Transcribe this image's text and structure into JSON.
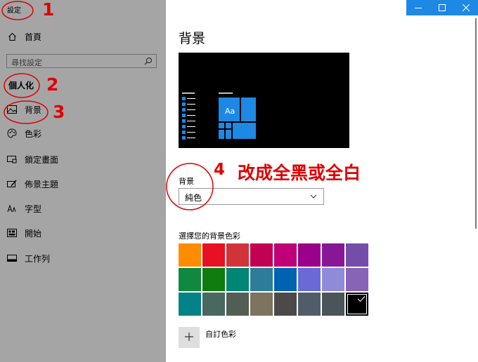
{
  "window": {
    "title": "設定",
    "controls": {
      "minimize": "—",
      "maximize": "☐",
      "close": "✕"
    },
    "accent_color": "#1e88e5"
  },
  "sidebar": {
    "home": {
      "label": "首頁",
      "icon": "home-icon"
    },
    "search": {
      "placeholder": "尋找設定",
      "icon": "search-icon"
    },
    "section_title": "個人化",
    "items": [
      {
        "label": "背景",
        "icon": "picture-icon"
      },
      {
        "label": "色彩",
        "icon": "palette-icon"
      },
      {
        "label": "鎖定畫面",
        "icon": "lock-screen-icon"
      },
      {
        "label": "佈景主題",
        "icon": "theme-brush-icon"
      },
      {
        "label": "字型",
        "icon": "font-icon"
      },
      {
        "label": "開始",
        "icon": "start-icon"
      },
      {
        "label": "工作列",
        "icon": "taskbar-icon"
      }
    ]
  },
  "main": {
    "title": "背景",
    "preview": {
      "tile_text": "Aa",
      "tile_color": "#1e88e5"
    },
    "background_label": "背景",
    "background_value": "純色",
    "color_label": "選擇您的背景色彩",
    "colors": [
      "#ff8c00",
      "#e81123",
      "#d13438",
      "#c30052",
      "#bf0077",
      "#9a0089",
      "#881798",
      "#744da9",
      "#10893e",
      "#107c10",
      "#018574",
      "#2d7d9a",
      "#0063b1",
      "#6b69d6",
      "#8e8cd8",
      "#8764b8",
      "#038387",
      "#486860",
      "#525e54",
      "#7e735f",
      "#4c4a48",
      "#515c6b",
      "#4a5459",
      "#000000"
    ],
    "selected_color_index": 23,
    "custom_color_label": "自訂色彩"
  },
  "annotations": {
    "numbers": [
      "1",
      "2",
      "3",
      "4"
    ],
    "note": "改成全黑或全白",
    "color": "#e00000"
  }
}
